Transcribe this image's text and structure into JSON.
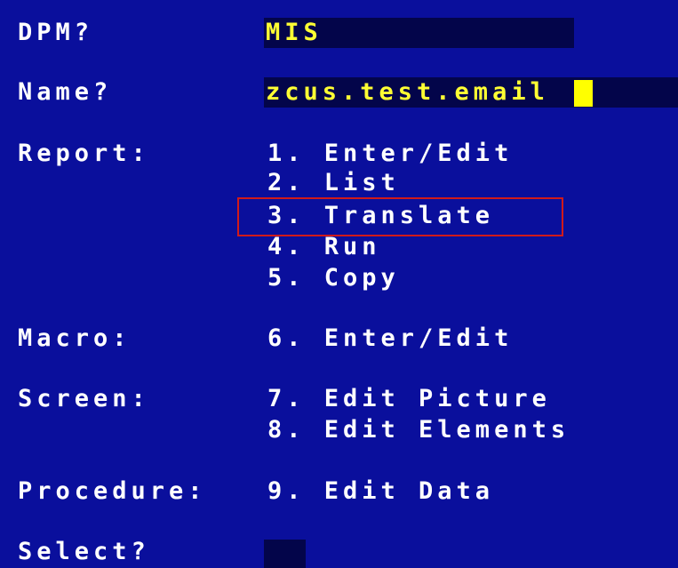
{
  "prompts": {
    "dpm": "DPM?",
    "name": "Name?",
    "report": "Report:",
    "macro": "Macro:",
    "screen": "Screen:",
    "procedure": "Procedure:",
    "select": "Select?"
  },
  "fields": {
    "dpm_value": "MIS",
    "name_value": "zcus.test.email",
    "select_value": ""
  },
  "menu": {
    "report": [
      "1. Enter/Edit",
      "2. List",
      "3. Translate",
      "4. Run",
      "5. Copy"
    ],
    "macro": [
      "6. Enter/Edit"
    ],
    "screen": [
      "7. Edit Picture",
      "8. Edit Elements"
    ],
    "procedure": [
      "9. Edit Data"
    ]
  },
  "highlighted_option": "3. Translate",
  "colors": {
    "background": "#0a0f9c",
    "field": "#03054a",
    "field_text": "#ffff33",
    "cursor": "#ffff00",
    "highlight_border": "#d11a1a"
  }
}
